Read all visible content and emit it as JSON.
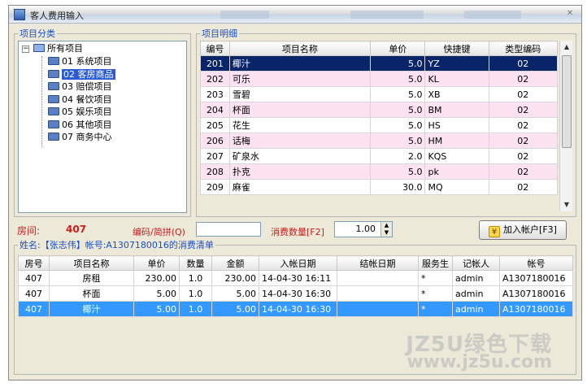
{
  "window": {
    "title": "客人费用输入"
  },
  "category_group": {
    "legend": "项目分类",
    "root": "所有项目",
    "items": [
      {
        "code": "01",
        "name": "系统项目"
      },
      {
        "code": "02",
        "name": "客房商品"
      },
      {
        "code": "03",
        "name": "赔偿项目"
      },
      {
        "code": "04",
        "name": "餐饮项目"
      },
      {
        "code": "05",
        "name": "娱乐项目"
      },
      {
        "code": "06",
        "name": "其他项目"
      },
      {
        "code": "07",
        "name": "商务中心"
      }
    ],
    "selected_index": 1
  },
  "detail_group": {
    "legend": "项目明细",
    "columns": [
      "编号",
      "项目名称",
      "单价",
      "快捷键",
      "类型编码"
    ],
    "rows": [
      {
        "id": "201",
        "name": "椰汁",
        "price": "5.0",
        "key": "YZ",
        "type": "02"
      },
      {
        "id": "202",
        "name": "可乐",
        "price": "5.0",
        "key": "KL",
        "type": "02"
      },
      {
        "id": "203",
        "name": "雪碧",
        "price": "5.0",
        "key": "XB",
        "type": "02"
      },
      {
        "id": "204",
        "name": "杯面",
        "price": "5.0",
        "key": "BM",
        "type": "02"
      },
      {
        "id": "205",
        "name": "花生",
        "price": "5.0",
        "key": "HS",
        "type": "02"
      },
      {
        "id": "206",
        "name": "话梅",
        "price": "5.0",
        "key": "HM",
        "type": "02"
      },
      {
        "id": "207",
        "name": "矿泉水",
        "price": "2.0",
        "key": "KQS",
        "type": "02"
      },
      {
        "id": "208",
        "name": "扑克",
        "price": "5.0",
        "key": "pk",
        "type": "02"
      },
      {
        "id": "209",
        "name": "麻雀",
        "price": "30.0",
        "key": "MQ",
        "type": "02"
      }
    ]
  },
  "controls": {
    "room_label": "房间:",
    "room_value": "407",
    "code_label": "编码/简拼(Q)",
    "code_value": "",
    "qty_label": "消费数量[F2]",
    "qty_value": "1.00",
    "add_button": "加入帐户[F3]"
  },
  "bill": {
    "legend": "姓名:【张志伟】帐号:A1307180016的消费清单",
    "columns": [
      "房号",
      "项目名称",
      "单价",
      "数量",
      "金额",
      "入帐日期",
      "结帐日期",
      "服务生",
      "记帐人",
      "帐号"
    ],
    "rows": [
      {
        "room": "407",
        "name": "房租",
        "price": "230.00",
        "qty": "1.0",
        "amount": "230.00",
        "date": "14-04-30 16:11",
        "checkout": "",
        "waiter": "*",
        "clerk": "admin",
        "account": "A1307180016"
      },
      {
        "room": "407",
        "name": "杯面",
        "price": "5.00",
        "qty": "1.0",
        "amount": "5.00",
        "date": "14-04-30 16:30",
        "checkout": "",
        "waiter": "*",
        "clerk": "admin",
        "account": "A1307180016"
      },
      {
        "room": "407",
        "name": "椰汁",
        "price": "5.00",
        "qty": "1.0",
        "amount": "5.00",
        "date": "14-04-30 16:30",
        "checkout": "",
        "waiter": "*",
        "clerk": "admin",
        "account": "A1307180016"
      }
    ]
  },
  "watermark": {
    "line1": "JZ5U绿色下载",
    "line2": "www.jz5u.com"
  },
  "colors": {
    "selected_dark": "#0a246a",
    "selected_blue": "#3399ff",
    "row_pink": "#fde2f2",
    "label_red": "#c81e1e"
  }
}
